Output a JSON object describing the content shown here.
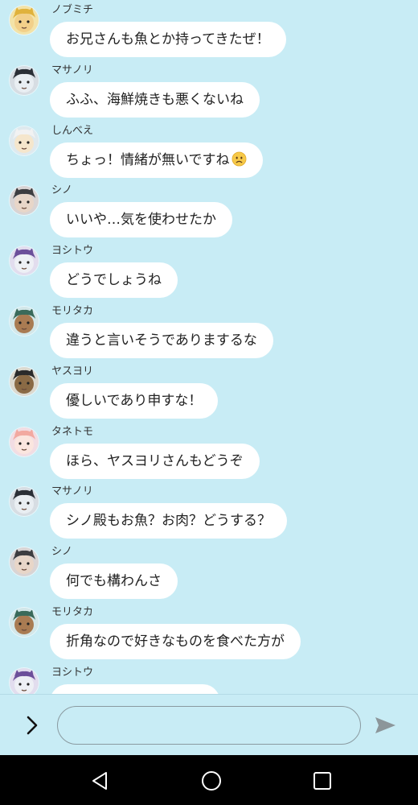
{
  "messages": [
    {
      "sender": "ノブミチ",
      "text": "お兄さんも魚とか持ってきたぜ！",
      "avatar": {
        "bg": "#f3e3a8",
        "hair": "#e0b23c",
        "skin": "#f2d08a"
      }
    },
    {
      "sender": "マサノリ",
      "text": "ふふ、海鮮焼きも悪くないね",
      "avatar": {
        "bg": "#d7dde3",
        "hair": "#2b2f36",
        "skin": "#e9eef2"
      }
    },
    {
      "sender": "しんべえ",
      "text": "ちょっ！情緒が無いですね",
      "emoji": "worried-face",
      "avatar": {
        "bg": "#dfe9ee",
        "hair": "#f2f2f2",
        "skin": "#f5e6cc"
      }
    },
    {
      "sender": "シノ",
      "text": "いいや…気を使わせたか",
      "avatar": {
        "bg": "#d9d4d4",
        "hair": "#3d3d40",
        "skin": "#e8d6c8"
      }
    },
    {
      "sender": "ヨシトウ",
      "text": "どうでしょうね",
      "avatar": {
        "bg": "#e2ddee",
        "hair": "#6c4f9a",
        "skin": "#eef0f5"
      }
    },
    {
      "sender": "モリタカ",
      "text": "違うと言いそうでありまするな",
      "avatar": {
        "bg": "#d3e7e9",
        "hair": "#3a6a5a",
        "skin": "#a97b52"
      }
    },
    {
      "sender": "ヤスヨリ",
      "text": "優しいであり申すな！",
      "avatar": {
        "bg": "#dcd9cf",
        "hair": "#2b2b2b",
        "skin": "#8a6a45"
      }
    },
    {
      "sender": "タネトモ",
      "text": "ほら、ヤスヨリさんもどうぞ",
      "avatar": {
        "bg": "#f2dde3",
        "hair": "#f2a9a0",
        "skin": "#fbe6df"
      }
    },
    {
      "sender": "マサノリ",
      "text": "シノ殿もお魚？お肉？どうする？",
      "avatar": {
        "bg": "#d7dde3",
        "hair": "#2b2f36",
        "skin": "#e9eef2"
      }
    },
    {
      "sender": "シノ",
      "text": "何でも構わんさ",
      "avatar": {
        "bg": "#d9d4d4",
        "hair": "#3d3d40",
        "skin": "#e8d6c8"
      }
    },
    {
      "sender": "モリタカ",
      "text": "折角なので好きなものを食べた方が",
      "avatar": {
        "bg": "#d3e7e9",
        "hair": "#3a6a5a",
        "skin": "#a97b52"
      }
    },
    {
      "sender": "ヨシトウ",
      "text": "",
      "avatar": {
        "bg": "#e2ddee",
        "hair": "#6c4f9a",
        "skin": "#eef0f5"
      }
    }
  ],
  "input": {
    "value": "",
    "placeholder": ""
  },
  "icons": {
    "expand": "chevron-right-icon",
    "send": "send-icon",
    "back": "back-triangle-icon",
    "home": "home-circle-icon",
    "recents": "recents-square-icon"
  },
  "colors": {
    "chat_background": "#c8ecf5",
    "bubble": "#ffffff",
    "nav_bar": "#000000"
  }
}
